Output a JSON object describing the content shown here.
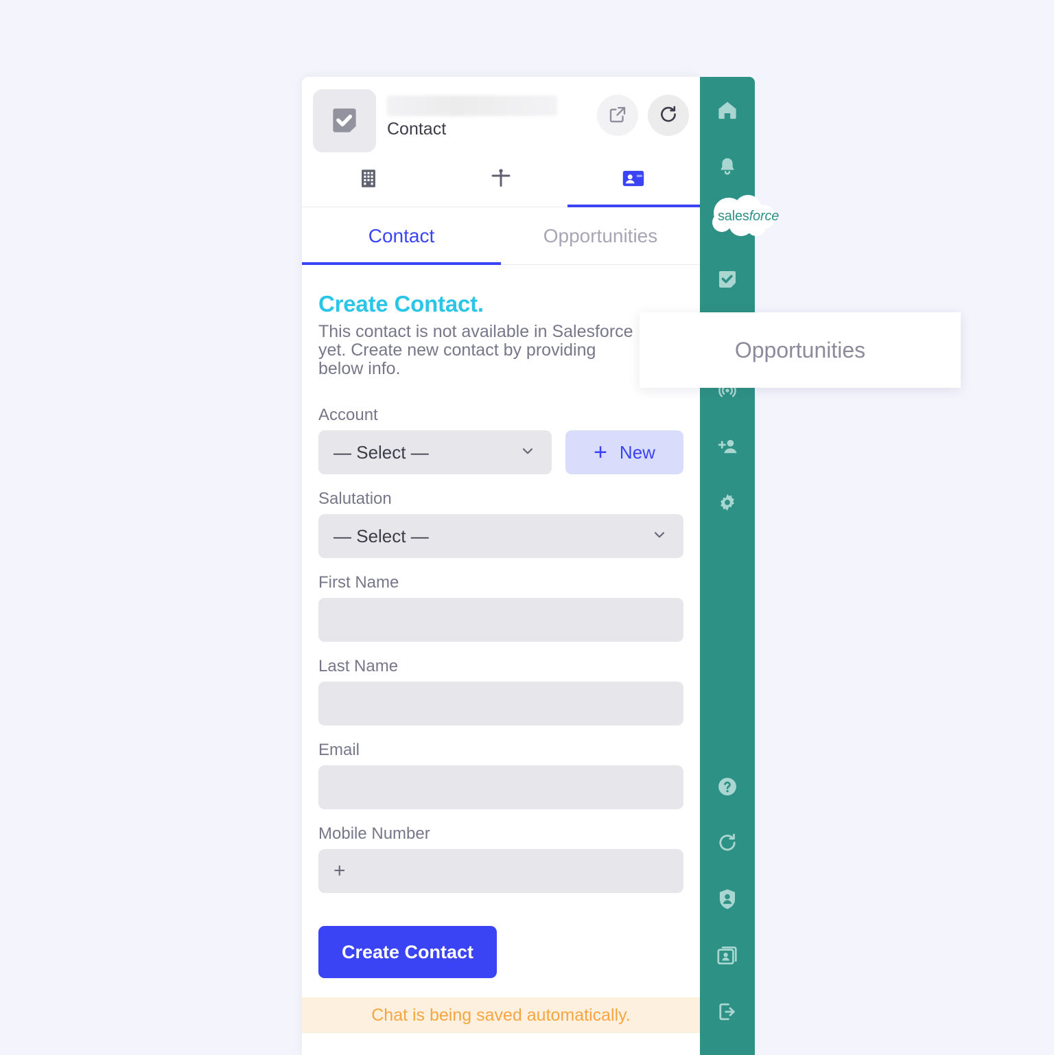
{
  "colors": {
    "page_background": "#F4F4FD",
    "rail_teal": "#2E9186",
    "accent_blue": "#3B44F5",
    "heading_cyan": "#2BC5E8",
    "notice_orange": "#F5A640",
    "notice_background": "#FDF0DE",
    "field_grey": "#E6E6EB",
    "new_button_background": "#D9DCFB"
  },
  "header": {
    "app_logo_icon": "checkbox-check-icon",
    "redacted_title": "",
    "subtitle": "Contact",
    "actions": [
      {
        "name": "open-external-button",
        "icon": "external-link-icon"
      },
      {
        "name": "refresh-button",
        "icon": "refresh-icon"
      }
    ]
  },
  "icon_tabs": [
    {
      "name": "tab-account",
      "icon": "building-icon",
      "active": false
    },
    {
      "name": "tab-lead",
      "icon": "person-icon",
      "active": false
    },
    {
      "name": "tab-contact",
      "icon": "contact-card-icon",
      "active": true
    }
  ],
  "text_tabs": [
    {
      "label": "Contact",
      "active": true
    },
    {
      "label": "Opportunities",
      "active": false
    }
  ],
  "form": {
    "title": "Create Contact.",
    "description": "This contact is not available in Salesforce yet. Create new contact by providing below info.",
    "fields": {
      "account": {
        "label": "Account",
        "select_value": "— Select —",
        "new_button_label": "New",
        "new_button_plus": "+"
      },
      "salutation": {
        "label": "Salutation",
        "select_value": "— Select —"
      },
      "first_name": {
        "label": "First Name",
        "value": "",
        "placeholder": ""
      },
      "last_name": {
        "label": "Last Name",
        "value": "",
        "placeholder": ""
      },
      "email": {
        "label": "Email",
        "value": "",
        "placeholder": ""
      },
      "mobile_number": {
        "label": "Mobile Number",
        "value": "",
        "prefix": "+",
        "placeholder": ""
      }
    },
    "submit_label": "Create Contact"
  },
  "notice": {
    "text": "Chat is being saved automatically."
  },
  "rail": {
    "top_items": [
      {
        "name": "rail-home",
        "icon": "home-icon"
      },
      {
        "name": "rail-notifications",
        "icon": "bell-icon"
      },
      {
        "name": "rail-salesforce",
        "icon": "salesforce-cloud-icon"
      },
      {
        "name": "rail-tasks",
        "icon": "checkbox-check-icon"
      },
      {
        "name": "rail-broadcast",
        "icon": "broadcast-icon"
      },
      {
        "name": "rail-add-user",
        "icon": "add-user-icon"
      },
      {
        "name": "rail-settings",
        "icon": "gear-icon"
      }
    ],
    "bottom_items": [
      {
        "name": "rail-help",
        "icon": "question-circle-icon"
      },
      {
        "name": "rail-refresh",
        "icon": "refresh-icon"
      },
      {
        "name": "rail-privacy",
        "icon": "shield-user-icon"
      },
      {
        "name": "rail-contacts",
        "icon": "contacts-book-icon"
      },
      {
        "name": "rail-logout",
        "icon": "logout-icon"
      }
    ]
  },
  "salesforce_badge": {
    "text_prefix": "sales",
    "text_italic": "force"
  },
  "tooltip": {
    "label": "Opportunities"
  }
}
